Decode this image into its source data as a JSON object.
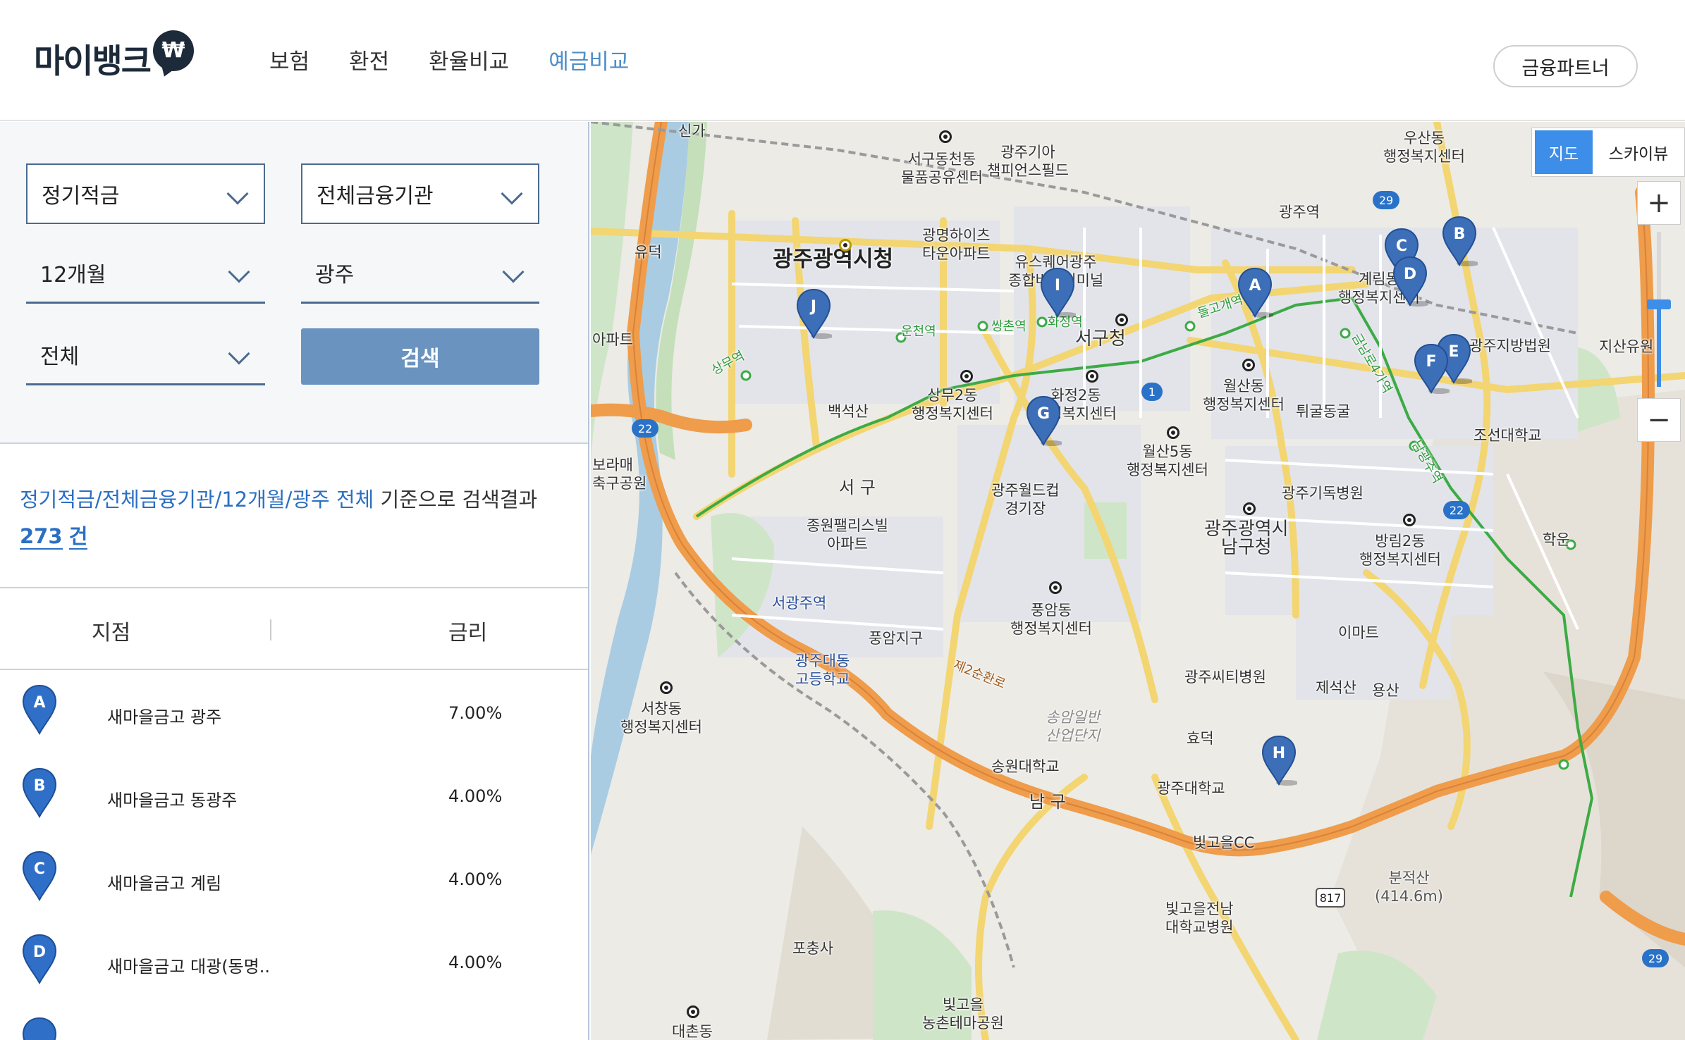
{
  "header": {
    "logo": "마이뱅크",
    "logo_badge": "₩",
    "nav": [
      "보험",
      "환전",
      "환율비교",
      "예금비교"
    ],
    "active_nav": "예금비교",
    "partner_button": "금융파트너"
  },
  "filters": {
    "product": "정기적금",
    "institution": "전체금융기관",
    "period": "12개월",
    "region": "광주",
    "district": "전체",
    "search_button": "검색"
  },
  "summary": {
    "criteria": "정기적금/전체금융기관/12개월/광주 전체",
    "text": " 기준으로 검색결과 ",
    "count": "273",
    "unit": "건"
  },
  "list": {
    "col_branch": "지점",
    "col_rate": "금리",
    "rows": [
      {
        "letter": "A",
        "name": "새마을금고 광주",
        "rate": "7.00%"
      },
      {
        "letter": "B",
        "name": "새마을금고 동광주",
        "rate": "4.00%"
      },
      {
        "letter": "C",
        "name": "새마을금고 계림",
        "rate": "4.00%"
      },
      {
        "letter": "D",
        "name": "새마을금고 대광(동명..",
        "rate": "4.00%"
      }
    ]
  },
  "map": {
    "maptype_map": "지도",
    "maptype_sky": "스카이뷰",
    "zoom_in": "+",
    "zoom_out": "−",
    "markers": [
      "A",
      "B",
      "C",
      "D",
      "E",
      "F",
      "G",
      "H",
      "I",
      "J"
    ],
    "labels": {
      "city_hall": "광주광역시청",
      "seogu_office": "서구청",
      "namgu_office": "광주광역시\n남구청",
      "seogu": "서 구",
      "namgu": "남 구",
      "gwangju_station": "광주역",
      "seogwangju_station": "서광주역",
      "champions_field": "광주기아\n챔피언스필드",
      "world_cup": "광주월드컵\n경기장",
      "honam_univ": "송원대학교",
      "gwangju_univ": "광주대학교",
      "chosun_univ": "조선대학교",
      "court": "광주지방법원",
      "christian_hospital": "광주기독병원",
      "city_hospital": "광주씨티병원",
      "bitgoeul_cc": "빛고을CC",
      "bitgoeul_hospital": "빛고을전남\n대학교병원",
      "bitgoeul_park": "빛고을\n농촌테마공원",
      "bunjeoksan": "분적산\n(414.6m)",
      "jeseoksan": "제석산",
      "baekseoksan": "백석산",
      "emart": "이마트",
      "pochungsa": "포충사",
      "daedong_hs": "광주대동\n고등학교",
      "songam": "송암일반\n산업단지",
      "jongwon": "종원팰리스빌\n아파트",
      "gwangmyeong": "광명하이츠\n타운아파트",
      "us_square": "유스퀘어광주\n종합버스터미널",
      "seodong": "서구동천동\n물품공유센터",
      "sangmu2": "상무2동\n행정복지센터",
      "hwajeong2": "화정2동\n행정복지센터",
      "wolsan": "월산동\n행정복지센터",
      "wolsan5": "월산5동\n행정복지센터",
      "bangrim2": "방림2동\n행정복지센터",
      "pungam": "풍암동\n행정복지센터",
      "seochang": "서창동\n행정복지센터",
      "gyerim": "계림동\n행정복지센터",
      "usan": "우산동\n행정복지센터",
      "pungam_jigu": "풍암지구",
      "hyodeok": "효덕",
      "yongsan": "용산",
      "hakun": "학운",
      "yudeok": "유덕",
      "singa": "신가",
      "jisan": "지산유원",
      "daechon": "대촌동",
      "boramae": "보라매\n축구공원",
      "apt": "아파트",
      "tigul": "튀굴동굴",
      "ring_road": "제2순환로"
    },
    "subway_stations": [
      "상무역",
      "운천역",
      "쌍촌역",
      "화정역",
      "돌고개역",
      "금남로4가역",
      "남광주역"
    ],
    "route_numbers": [
      "22",
      "29",
      "1",
      "817"
    ]
  }
}
